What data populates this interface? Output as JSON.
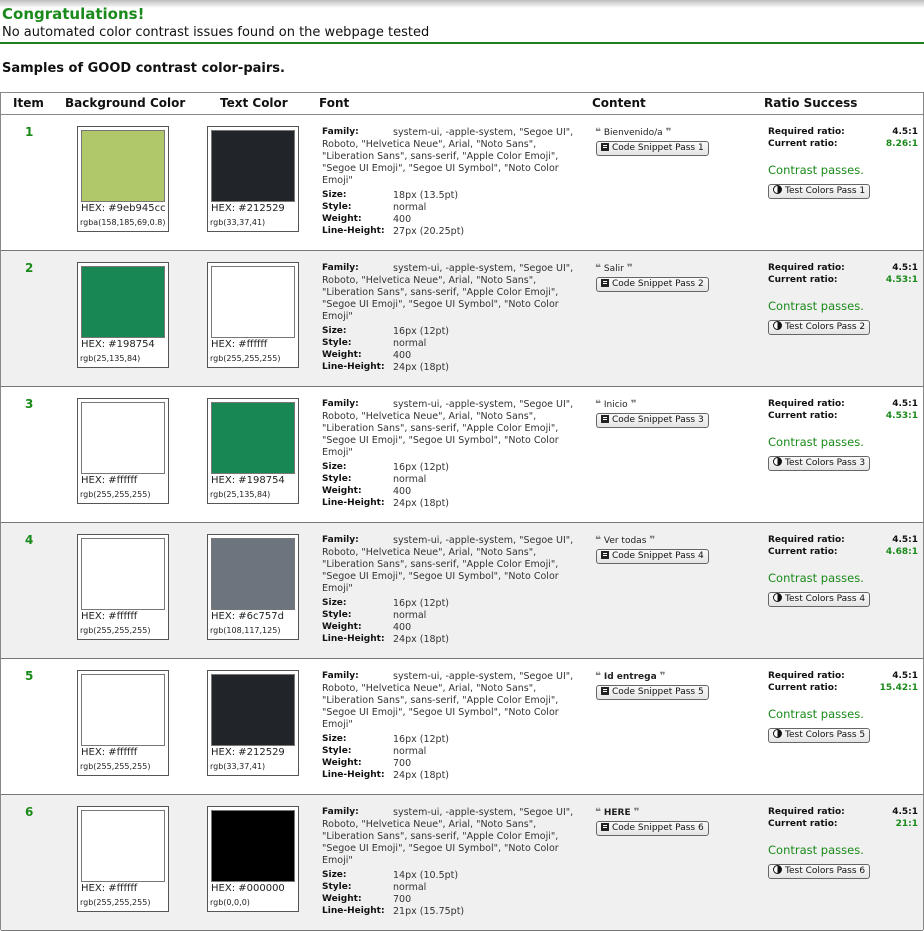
{
  "header": {
    "title": "Congratulations!",
    "subtitle": "No automated color contrast issues found on the webpage tested",
    "samples_title": "Samples of GOOD contrast color-pairs."
  },
  "columns": {
    "item": "Item",
    "background": "Background Color",
    "text": "Text Color",
    "font": "Font",
    "content": "Content",
    "ratio": "Ratio Success"
  },
  "labels": {
    "family": "Family:",
    "size": "Size:",
    "style": "Style:",
    "weight": "Weight:",
    "line_height": "Line-Height:",
    "required_ratio": "Required ratio:",
    "current_ratio": "Current ratio:",
    "contrast_passes": "Contrast passes.",
    "open_quote": "❝",
    "close_quote": "❞"
  },
  "colors": {
    "success_green": "#1a8a1a",
    "rule_green": "#1e7d1e",
    "alt_row": "#f0f0f0"
  },
  "icons": {
    "snippet": "document-icon",
    "test": "contrast-icon"
  },
  "rows": [
    {
      "item": "1",
      "bg": {
        "hex": "HEX: #9eb945cc",
        "rgb": "rgba(158,185,69,0.8)",
        "color": "#b1c86a"
      },
      "fg": {
        "hex": "HEX: #212529",
        "rgb": "rgb(33,37,41)",
        "color": "#212529"
      },
      "font": {
        "family": "system-ui, -apple-system, \"Segoe UI\", Roboto, \"Helvetica Neue\", Arial, \"Noto Sans\", \"Liberation Sans\", sans-serif, \"Apple Color Emoji\", \"Segoe UI Emoji\", \"Segoe UI Symbol\", \"Noto Color Emoji\"",
        "size": "18px (13.5pt)",
        "style": "normal",
        "weight": "400",
        "line_height": "27px (20.25pt)"
      },
      "content": {
        "text": "Bienvenido/a",
        "bold": false,
        "snippet_button": "Code Snippet Pass 1",
        "test_button": "Test Colors Pass 1"
      },
      "ratio": {
        "required": "4.5:1",
        "current": "8.26:1"
      }
    },
    {
      "item": "2",
      "bg": {
        "hex": "HEX: #198754",
        "rgb": "rgb(25,135,84)",
        "color": "#198754"
      },
      "fg": {
        "hex": "HEX: #ffffff",
        "rgb": "rgb(255,255,255)",
        "color": "#ffffff"
      },
      "font": {
        "family": "system-ui, -apple-system, \"Segoe UI\", Roboto, \"Helvetica Neue\", Arial, \"Noto Sans\", \"Liberation Sans\", sans-serif, \"Apple Color Emoji\", \"Segoe UI Emoji\", \"Segoe UI Symbol\", \"Noto Color Emoji\"",
        "size": "16px (12pt)",
        "style": "normal",
        "weight": "400",
        "line_height": "24px (18pt)"
      },
      "content": {
        "text": "Salir",
        "bold": false,
        "snippet_button": "Code Snippet Pass 2",
        "test_button": "Test Colors Pass 2"
      },
      "ratio": {
        "required": "4.5:1",
        "current": "4.53:1"
      }
    },
    {
      "item": "3",
      "bg": {
        "hex": "HEX: #ffffff",
        "rgb": "rgb(255,255,255)",
        "color": "#ffffff"
      },
      "fg": {
        "hex": "HEX: #198754",
        "rgb": "rgb(25,135,84)",
        "color": "#198754"
      },
      "font": {
        "family": "system-ui, -apple-system, \"Segoe UI\", Roboto, \"Helvetica Neue\", Arial, \"Noto Sans\", \"Liberation Sans\", sans-serif, \"Apple Color Emoji\", \"Segoe UI Emoji\", \"Segoe UI Symbol\", \"Noto Color Emoji\"",
        "size": "16px (12pt)",
        "style": "normal",
        "weight": "400",
        "line_height": "24px (18pt)"
      },
      "content": {
        "text": "Inicio",
        "bold": false,
        "snippet_button": "Code Snippet Pass 3",
        "test_button": "Test Colors Pass 3"
      },
      "ratio": {
        "required": "4.5:1",
        "current": "4.53:1"
      }
    },
    {
      "item": "4",
      "bg": {
        "hex": "HEX: #ffffff",
        "rgb": "rgb(255,255,255)",
        "color": "#ffffff"
      },
      "fg": {
        "hex": "HEX: #6c757d",
        "rgb": "rgb(108,117,125)",
        "color": "#6c757d"
      },
      "font": {
        "family": "system-ui, -apple-system, \"Segoe UI\", Roboto, \"Helvetica Neue\", Arial, \"Noto Sans\", \"Liberation Sans\", sans-serif, \"Apple Color Emoji\", \"Segoe UI Emoji\", \"Segoe UI Symbol\", \"Noto Color Emoji\"",
        "size": "16px (12pt)",
        "style": "normal",
        "weight": "400",
        "line_height": "24px (18pt)"
      },
      "content": {
        "text": "Ver todas",
        "bold": false,
        "snippet_button": "Code Snippet Pass 4",
        "test_button": "Test Colors Pass 4"
      },
      "ratio": {
        "required": "4.5:1",
        "current": "4.68:1"
      }
    },
    {
      "item": "5",
      "bg": {
        "hex": "HEX: #ffffff",
        "rgb": "rgb(255,255,255)",
        "color": "#ffffff"
      },
      "fg": {
        "hex": "HEX: #212529",
        "rgb": "rgb(33,37,41)",
        "color": "#212529"
      },
      "font": {
        "family": "system-ui, -apple-system, \"Segoe UI\", Roboto, \"Helvetica Neue\", Arial, \"Noto Sans\", \"Liberation Sans\", sans-serif, \"Apple Color Emoji\", \"Segoe UI Emoji\", \"Segoe UI Symbol\", \"Noto Color Emoji\"",
        "size": "16px (12pt)",
        "style": "normal",
        "weight": "700",
        "line_height": "24px (18pt)"
      },
      "content": {
        "text": "Id entrega",
        "bold": true,
        "snippet_button": "Code Snippet Pass 5",
        "test_button": "Test Colors Pass 5"
      },
      "ratio": {
        "required": "4.5:1",
        "current": "15.42:1"
      }
    },
    {
      "item": "6",
      "bg": {
        "hex": "HEX: #ffffff",
        "rgb": "rgb(255,255,255)",
        "color": "#ffffff"
      },
      "fg": {
        "hex": "HEX: #000000",
        "rgb": "rgb(0,0,0)",
        "color": "#000000"
      },
      "font": {
        "family": "system-ui, -apple-system, \"Segoe UI\", Roboto, \"Helvetica Neue\", Arial, \"Noto Sans\", \"Liberation Sans\", sans-serif, \"Apple Color Emoji\", \"Segoe UI Emoji\", \"Segoe UI Symbol\", \"Noto Color Emoji\"",
        "size": "14px (10.5pt)",
        "style": "normal",
        "weight": "700",
        "line_height": "21px (15.75pt)"
      },
      "content": {
        "text": "HERE",
        "bold": true,
        "snippet_button": "Code Snippet Pass 6",
        "test_button": "Test Colors Pass 6"
      },
      "ratio": {
        "required": "4.5:1",
        "current": "21:1"
      }
    }
  ]
}
